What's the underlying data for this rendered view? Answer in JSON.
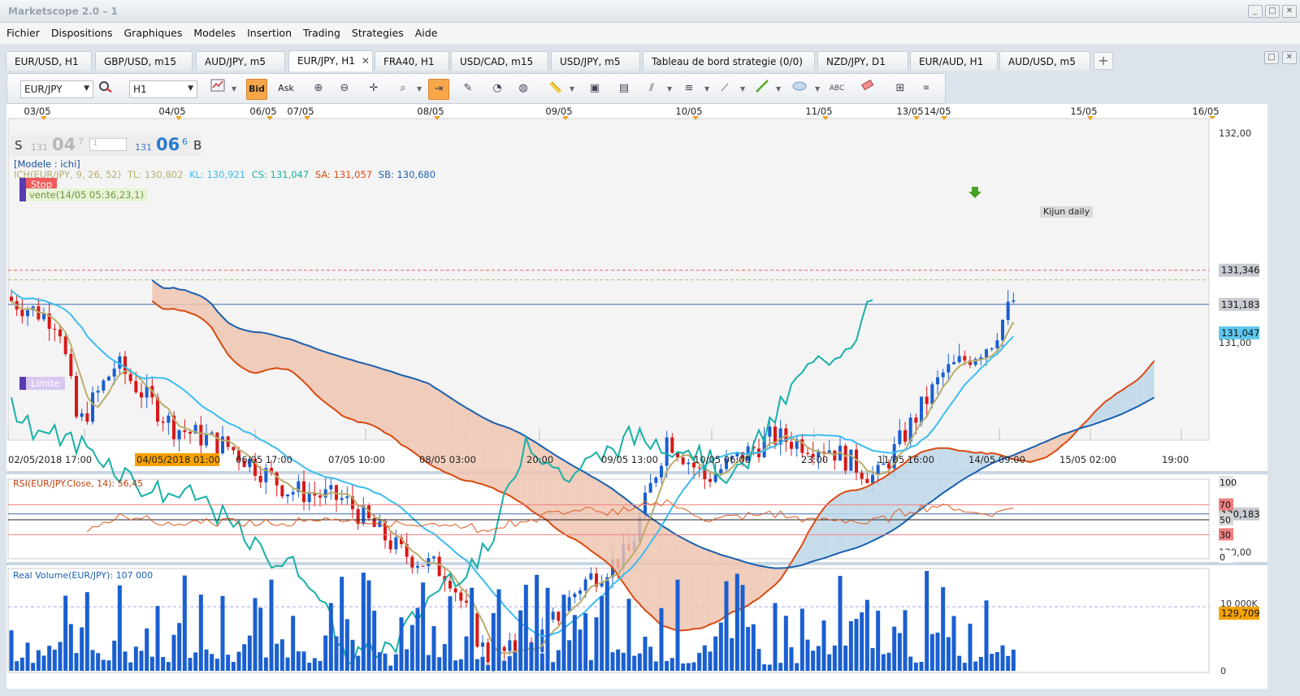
{
  "window": {
    "title": "Marketscope 2.0 – 1"
  },
  "menu": [
    "Fichier",
    "Dispositions",
    "Graphiques",
    "Modeles",
    "Insertion",
    "Trading",
    "Strategies",
    "Aide"
  ],
  "tabs": [
    {
      "label": "EUR/USD, H1"
    },
    {
      "label": "GBP/USD, m15"
    },
    {
      "label": "AUD/JPY, m5"
    },
    {
      "label": "EUR/JPY, H1",
      "active": true,
      "close": "✕"
    },
    {
      "label": "FRA40, H1"
    },
    {
      "label": "USD/CAD, m15"
    },
    {
      "label": "USD/JPY, m5"
    },
    {
      "label": "Tableau de bord strategie (0/0)"
    },
    {
      "label": "NZD/JPY, D1"
    },
    {
      "label": "EUR/AUD, H1"
    },
    {
      "label": "AUD/USD, m5"
    }
  ],
  "toolbar": {
    "instrument": "EUR/JPY",
    "timeframe": "H1",
    "bid_label": "Bid",
    "ask_label": "Ask"
  },
  "price_panel": {
    "top_dates": [
      "03/05",
      "04/05",
      "06/05",
      "07/05",
      "08/05",
      "09/05",
      "10/05",
      "11/05",
      "13/05",
      "14/05",
      "15/05",
      "16/05"
    ],
    "bottom_dates": [
      "02/05/2018 17:00",
      "04/05/2018 01:00",
      "06/05 17:00",
      "07/05 10:00",
      "08/05 03:00",
      "20:00",
      "09/05 13:00",
      "10/05 06:00",
      "23:00",
      "11/05 16:00",
      "14/05 09:00",
      "15/05 02:00",
      "19:00"
    ],
    "selected_date": "04/05/2018 01:00",
    "y_ticks": [
      "132,00",
      "131,00",
      "130,00"
    ],
    "price_tags": [
      {
        "value": "131,346",
        "color": "#c8ccd2"
      },
      {
        "value": "131,183",
        "color": "#c8ccd2"
      },
      {
        "value": "131,047",
        "color": "#5ec8f0"
      },
      {
        "value": "130,183",
        "color": "#c8ccd2"
      },
      {
        "value": "129,709",
        "color": "#f7a200"
      }
    ],
    "quote": {
      "s_label": "S",
      "sell_big": "131",
      "sell_pips": "04",
      "sell_frac": "7",
      "buy_big": "131",
      "buy_pips": "06",
      "buy_frac": "6",
      "b_label": "B",
      "amount": "1"
    },
    "model": "[Modele : ichi]",
    "ichimoku_legend": {
      "name": "ICH(EUR/JPY, 9, 26, 52)",
      "tl": "TL: 130,802",
      "kl": "KL: 130,921",
      "cs": "CS: 131,047",
      "sa": "SA: 131,057",
      "sb": "SB: 130,680"
    },
    "orders": {
      "stop": "Stop",
      "vente": "vente(14/05 05:36,23,1)",
      "limite": "Limite",
      "kijun": "Kijun daily"
    }
  },
  "rsi_panel": {
    "label": "RSI(EUR/JPY.Close, 14): 56,45",
    "levels": [
      "100",
      "70",
      "50",
      "30",
      "0"
    ]
  },
  "volume_panel": {
    "label": "Real Volume(EUR/JPY): 107 000",
    "ticks": [
      "10 000K",
      "0"
    ]
  },
  "colors": {
    "tenkan": "#b9ad6e",
    "kijun": "#3cbcf0",
    "chikou": "#16b0a8",
    "senkou_a": "#d84a10",
    "senkou_b": "#1a5fb0",
    "up": "#1a5fd0",
    "down": "#d81818",
    "volume": "#1a5fd0",
    "rsi": "#e05a20"
  }
}
